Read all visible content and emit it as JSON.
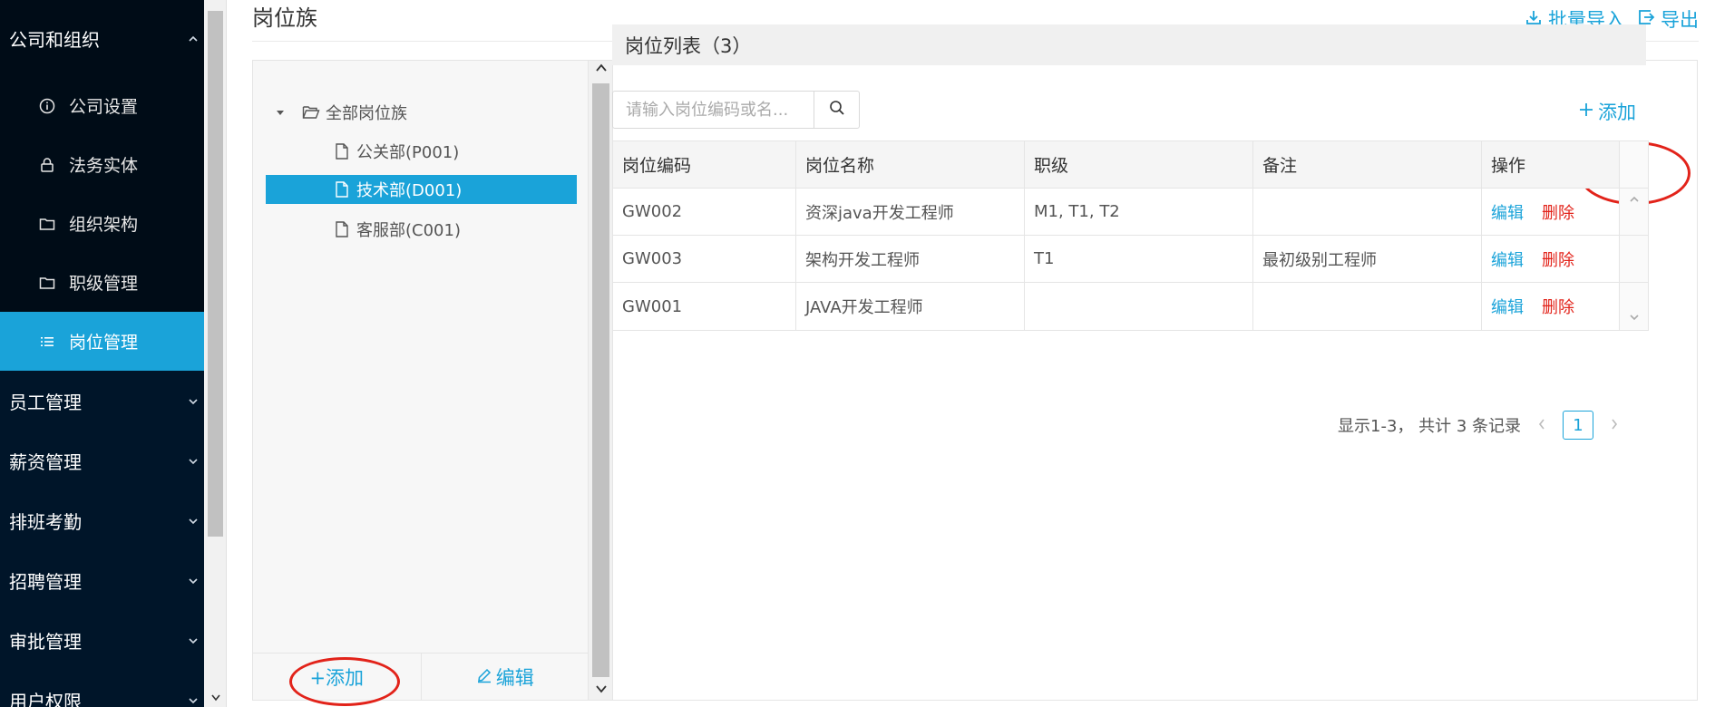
{
  "sidebar": {
    "groups": [
      {
        "label": "公司和组织"
      },
      {
        "label": "员工管理"
      },
      {
        "label": "薪资管理"
      },
      {
        "label": "排班考勤"
      },
      {
        "label": "招聘管理"
      },
      {
        "label": "审批管理"
      },
      {
        "label": "用户权限"
      }
    ],
    "sub_items": [
      {
        "label": "公司设置",
        "icon": "info-icon"
      },
      {
        "label": "法务实体",
        "icon": "lock-icon"
      },
      {
        "label": "组织架构",
        "icon": "folder-icon"
      },
      {
        "label": "职级管理",
        "icon": "folder-icon"
      },
      {
        "label": "岗位管理",
        "icon": "list-icon",
        "active": true
      }
    ]
  },
  "header": {
    "title": "岗位族",
    "import_label": "批量导入",
    "export_label": "导出"
  },
  "tree": {
    "root": "全部岗位族",
    "children": [
      "公关部(P001)",
      "技术部(D001)",
      "客服部(C001)"
    ],
    "selected_index": 1,
    "add_label": "+添加",
    "edit_label": "编辑"
  },
  "list": {
    "header": "岗位列表（3）",
    "search_placeholder": "请输入岗位编码或名...",
    "add_label": "添加",
    "columns": [
      "岗位编码",
      "岗位名称",
      "职级",
      "备注",
      "操作"
    ],
    "rows": [
      {
        "code": "GW002",
        "name": "资深java开发工程师",
        "level": "M1, T1, T2",
        "note": "",
        "edit": "编辑",
        "delete": "删除"
      },
      {
        "code": "GW003",
        "name": "架构开发工程师",
        "level": "T1",
        "note": "最初级别工程师",
        "edit": "编辑",
        "delete": "删除"
      },
      {
        "code": "GW001",
        "name": "JAVA开发工程师",
        "level": "",
        "note": "",
        "edit": "编辑",
        "delete": "删除"
      }
    ]
  },
  "pager": {
    "summary": "显示1-3， 共计 3 条记录",
    "current_page": "1"
  },
  "colors": {
    "accent": "#1aa3d9",
    "sidebar_bg": "#001529",
    "danger": "#e2231a"
  }
}
